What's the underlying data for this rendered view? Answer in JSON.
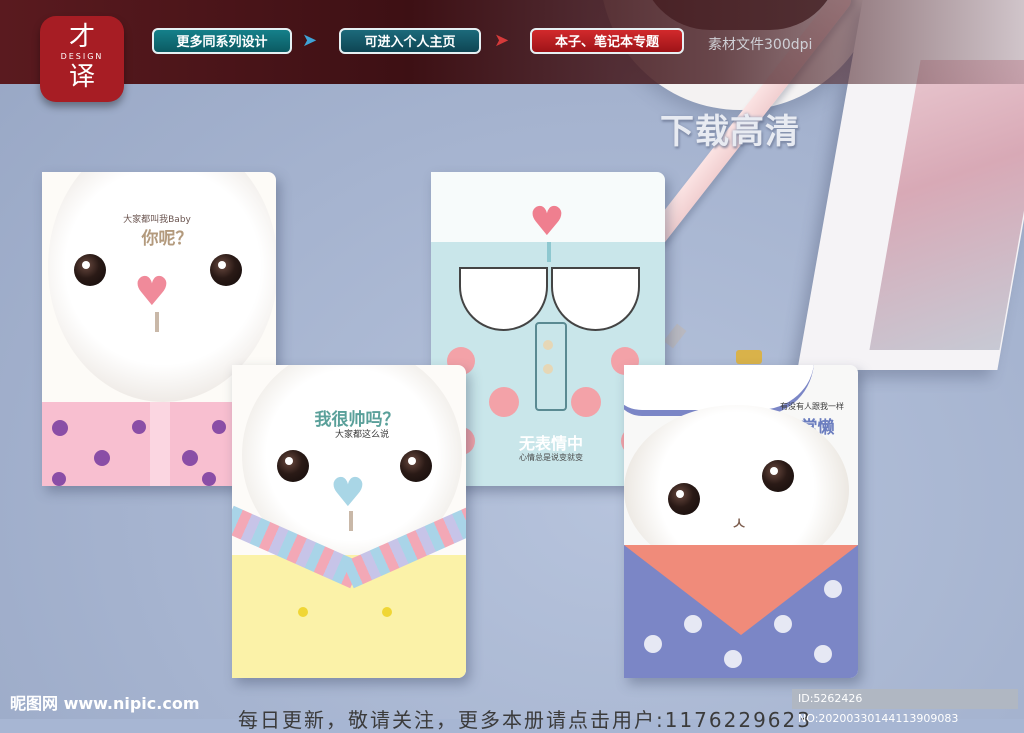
{
  "banner": {
    "logo_top": "才",
    "logo_mid": "DESIGN",
    "logo_bot": "译",
    "btn_series": "更多同系列设计",
    "btn_home": "可进入个人主页",
    "btn_topic": "本子、笔记本专题",
    "resolution": "素材文件300dpi"
  },
  "hd_label": "下载高清",
  "notebooks": {
    "nb1": {
      "small": "大家都叫我Baby",
      "big": "你呢？"
    },
    "nb2": {
      "big": "我很帅吗？",
      "small": "大家都这么说"
    },
    "nb3": {
      "big": "无表情中",
      "small": "心情总是说变就变"
    },
    "nb4": {
      "small": "有没有人跟我一样",
      "big": "非常懒"
    }
  },
  "footer": {
    "watermark": "昵图网 www.nipic.com",
    "bottom_text": "每日更新，敬请关注，更多本册请点击用户:1176229623",
    "id_text": "ID:5262426 NO:20200330144113909083"
  },
  "colors": {
    "accent_red": "#a71d24",
    "teal": "#15808a",
    "pink": "#f6b7c4",
    "blue": "#7b86c6"
  }
}
